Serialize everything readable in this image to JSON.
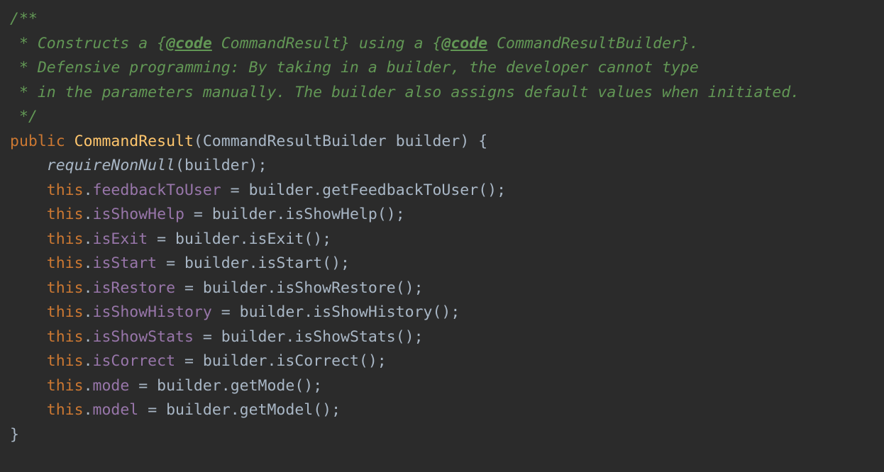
{
  "doc": {
    "l1": "/**",
    "l2a": " * Constructs a {",
    "l2tag": "@code",
    "l2b": " CommandResult} using a {",
    "l2tag2": "@code",
    "l2c": " CommandResultBuilder}.",
    "l3": " * Defensive programming: By taking in a builder, the developer cannot type",
    "l4": " * in the parameters manually. The builder also assigns default values when initiated.",
    "l5": " */"
  },
  "sig": {
    "kw_public": "public",
    "name": "CommandResult",
    "lparen": "(",
    "param_type": "CommandResultBuilder",
    "param_name": "builder",
    "rparen_brace": ") {"
  },
  "body": {
    "requireNonNull": "requireNonNull",
    "builder_arg": "(builder);",
    "this": "this",
    "dot": ".",
    "eq": " = ",
    "builder": "builder",
    "semi": ";",
    "empty_parens_semi": "();",
    "fields": {
      "feedbackToUser": "feedbackToUser",
      "isShowHelp": "isShowHelp",
      "isExit": "isExit",
      "isStart": "isStart",
      "isRestore": "isRestore",
      "isShowHistory": "isShowHistory",
      "isShowStats": "isShowStats",
      "isCorrect": "isCorrect",
      "mode": "mode",
      "model": "model"
    },
    "getters": {
      "getFeedbackToUser": "getFeedbackToUser",
      "isShowHelp": "isShowHelp",
      "isExit": "isExit",
      "isStart": "isStart",
      "isShowRestore": "isShowRestore",
      "isShowHistory": "isShowHistory",
      "isShowStats": "isShowStats",
      "isCorrect": "isCorrect",
      "getMode": "getMode",
      "getModel": "getModel"
    }
  },
  "close_brace": "}"
}
